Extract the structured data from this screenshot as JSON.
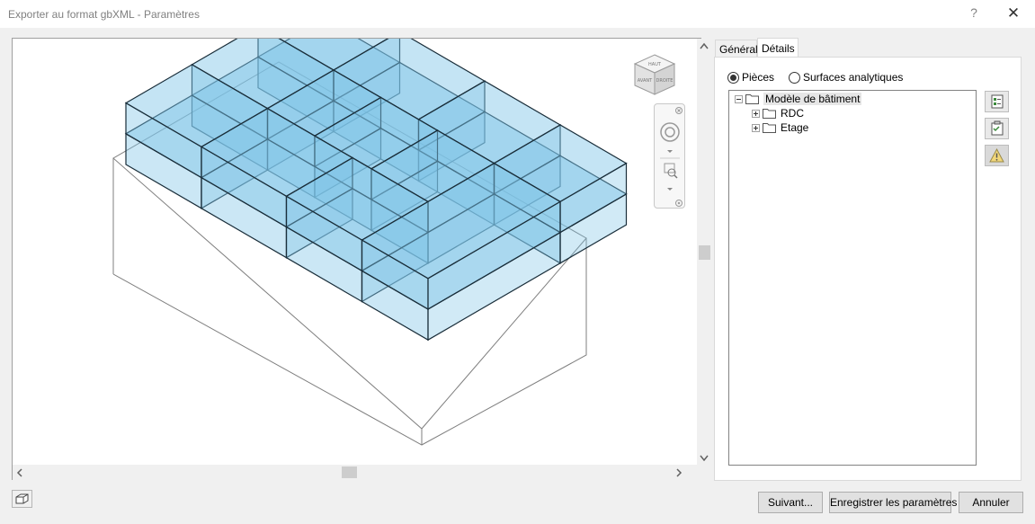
{
  "window": {
    "title": "Exporter au format gbXML - Paramètres",
    "help_label": "?",
    "close_label": "✕"
  },
  "viewport": {
    "viewcube_faces": [
      "HAUT",
      "AVANT",
      "DROITE"
    ],
    "scroll_left": "<",
    "scroll_right": ">",
    "scroll_up": "^",
    "scroll_down": "v"
  },
  "tabs": [
    {
      "label": "Général",
      "active": false
    },
    {
      "label": "Détails",
      "active": true
    }
  ],
  "details": {
    "radio_options": [
      {
        "label": "Pièces",
        "checked": true
      },
      {
        "label": "Surfaces analytiques",
        "checked": false
      }
    ],
    "tree": {
      "root": "Modèle de bâtiment",
      "children": [
        "RDC",
        "Etage"
      ]
    },
    "side_buttons": [
      "select-rooms-icon",
      "room-properties-icon",
      "warning-icon"
    ]
  },
  "buttons": {
    "next": "Suivant...",
    "save_settings": "Enregistrer les paramètres",
    "cancel": "Annuler"
  },
  "colors": {
    "room_fill": "#7cc3e6",
    "room_stroke": "#1a2e3a"
  }
}
